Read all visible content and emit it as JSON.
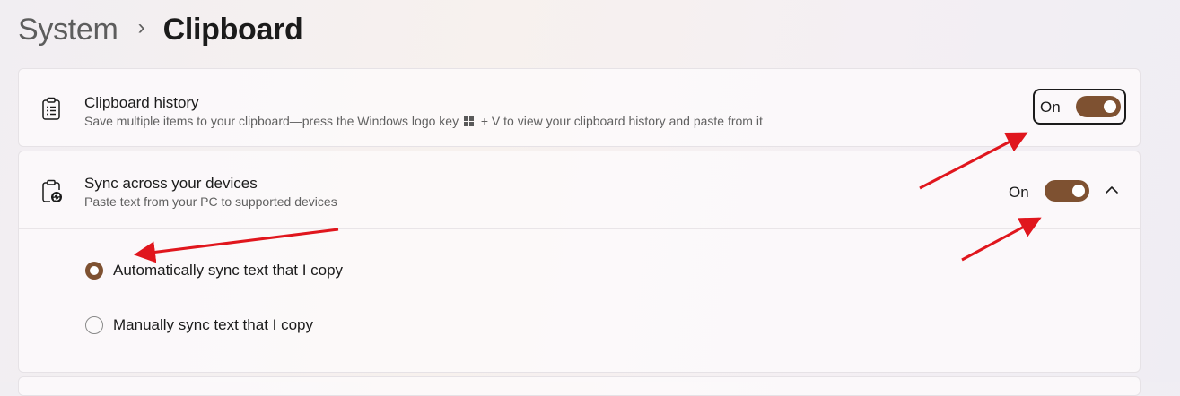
{
  "breadcrumb": {
    "parent": "System",
    "separator": "›",
    "current": "Clipboard"
  },
  "clipboard_history": {
    "title": "Clipboard history",
    "description_before": "Save multiple items to your clipboard—press the Windows logo key",
    "description_after": "+ V to view your clipboard history and paste from it",
    "icon": "clipboard-list-icon",
    "toggle_label": "On",
    "toggle_on": true
  },
  "sync": {
    "title": "Sync across your devices",
    "description": "Paste text from your PC to supported devices",
    "icon": "clipboard-sync-icon",
    "toggle_label": "On",
    "toggle_on": true,
    "expanded": true,
    "options": [
      {
        "label": "Automatically sync text that I copy",
        "selected": true
      },
      {
        "label": "Manually sync text that I copy",
        "selected": false
      }
    ]
  },
  "colors": {
    "accent": "#7e5131",
    "annotation": "#e0161d"
  }
}
